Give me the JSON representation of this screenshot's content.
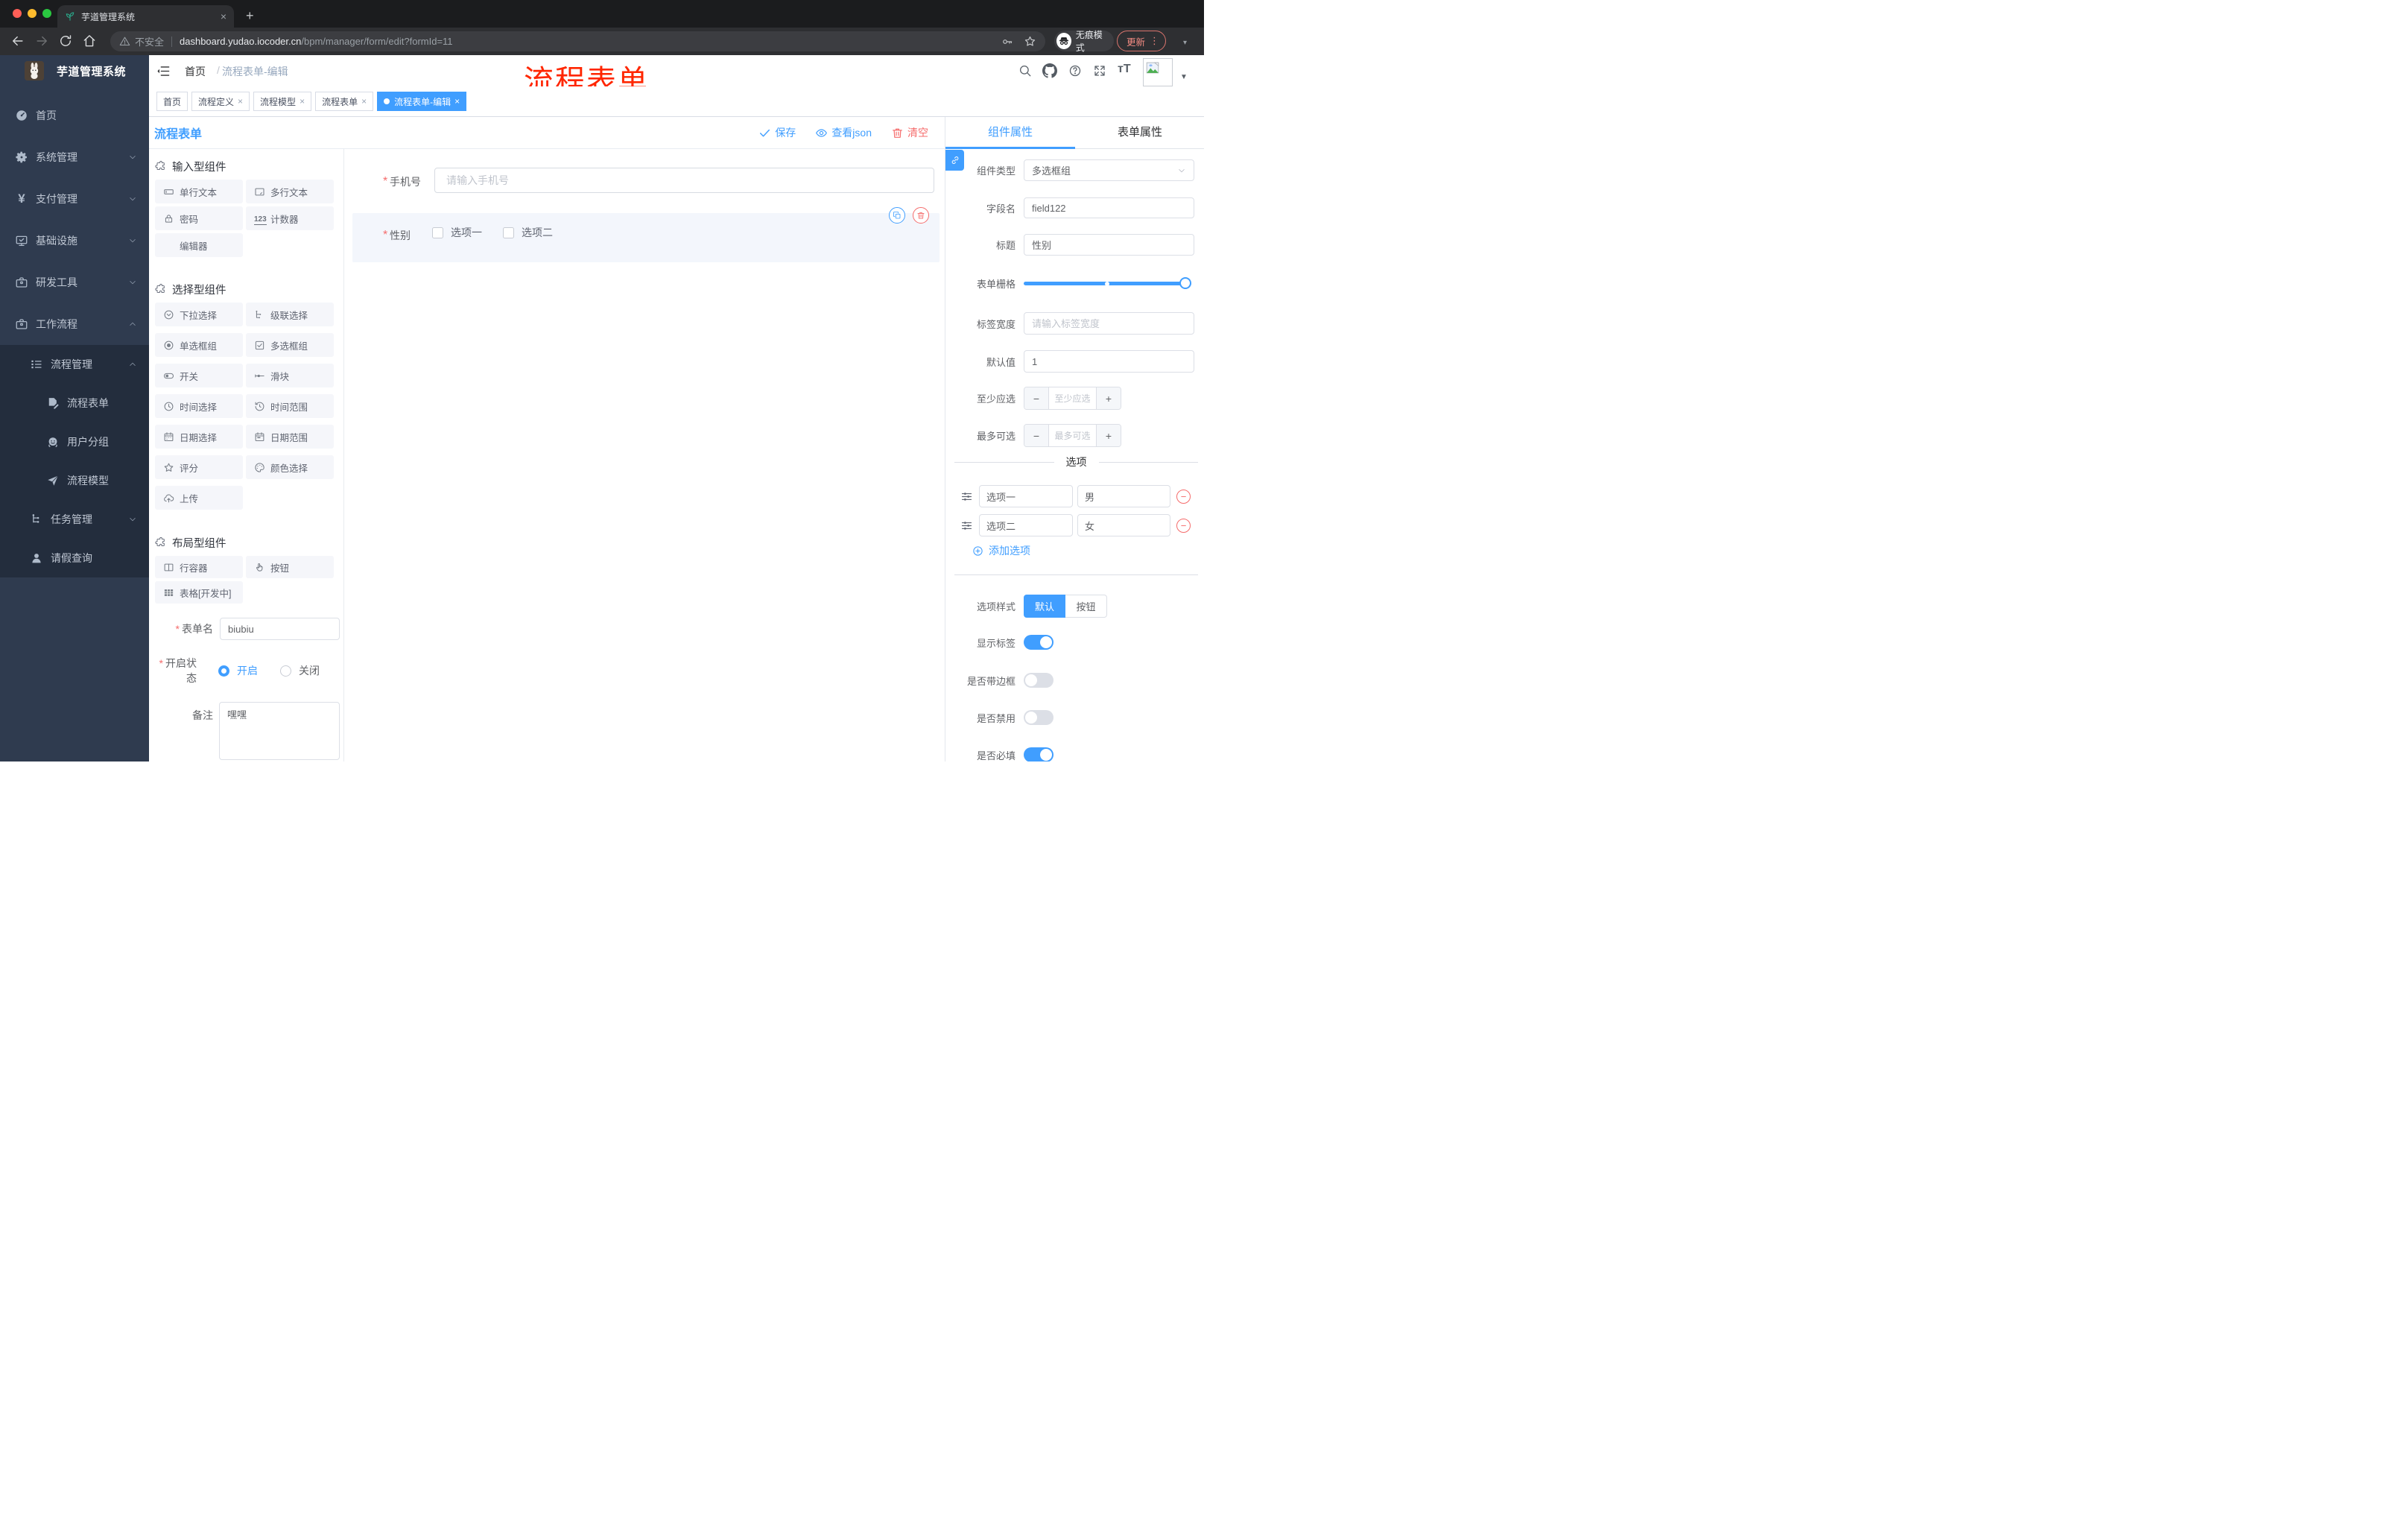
{
  "browser": {
    "tab_title": "芋道管理系统",
    "close_glyph": "×",
    "new_tab_glyph": "+",
    "security_label": "不安全",
    "url_host": "dashboard.yudao.iocoder.cn",
    "url_path": "/bpm/manager/form/edit?formId=11",
    "incognito_label": "无痕模式",
    "update_label": "更新",
    "menu_dots": "⋮"
  },
  "annotation": {
    "text": "流程表单",
    "color": "#ff2600"
  },
  "sidebar": {
    "logo_title": "芋道管理系统",
    "items": [
      {
        "label": "首页",
        "icon": "dashboard-icon",
        "depth": 0,
        "chevron": "",
        "sub": false
      },
      {
        "label": "系统管理",
        "icon": "gear-icon",
        "depth": 0,
        "chevron": "down",
        "sub": false
      },
      {
        "label": "支付管理",
        "icon": "yen-icon",
        "depth": 0,
        "chevron": "down",
        "sub": false
      },
      {
        "label": "基础设施",
        "icon": "monitor-icon",
        "depth": 0,
        "chevron": "down",
        "sub": false
      },
      {
        "label": "研发工具",
        "icon": "toolbox-icon",
        "depth": 0,
        "chevron": "down",
        "sub": false
      },
      {
        "label": "工作流程",
        "icon": "briefcase-icon",
        "depth": 0,
        "chevron": "up",
        "sub": false
      },
      {
        "label": "流程管理",
        "icon": "list-tree-icon",
        "depth": 1,
        "chevron": "up",
        "sub": true
      },
      {
        "label": "流程表单",
        "icon": "doc-edit-icon",
        "depth": 2,
        "chevron": "",
        "sub": true
      },
      {
        "label": "用户分组",
        "icon": "face-icon",
        "depth": 2,
        "chevron": "",
        "sub": true
      },
      {
        "label": "流程模型",
        "icon": "send-icon",
        "depth": 2,
        "chevron": "",
        "sub": true
      },
      {
        "label": "任务管理",
        "icon": "org-icon",
        "depth": 1,
        "chevron": "down",
        "sub": true
      },
      {
        "label": "请假查询",
        "icon": "user-icon",
        "depth": 1,
        "chevron": "",
        "sub": true
      }
    ]
  },
  "header": {
    "breadcrumb_home": "首页",
    "breadcrumb_sep": "/",
    "breadcrumb_current": "流程表单-编辑"
  },
  "tags": [
    {
      "label": "首页",
      "closable": false,
      "active": false
    },
    {
      "label": "流程定义",
      "closable": true,
      "active": false
    },
    {
      "label": "流程模型",
      "closable": true,
      "active": false
    },
    {
      "label": "流程表单",
      "closable": true,
      "active": false
    },
    {
      "label": "流程表单-编辑",
      "closable": true,
      "active": true
    }
  ],
  "designer_toolbar": {
    "title": "流程表单",
    "save_label": "保存",
    "view_json_label": "查看json",
    "clear_label": "清空"
  },
  "palette": {
    "sections": [
      {
        "title": "输入型组件",
        "items": [
          {
            "label": "单行文本",
            "icon": "input-icon"
          },
          {
            "label": "多行文本",
            "icon": "textarea-icon"
          },
          {
            "label": "密码",
            "icon": "lock-icon"
          },
          {
            "label": "计数器",
            "icon": "number-123-icon"
          },
          {
            "label": "编辑器",
            "icon": ""
          }
        ]
      },
      {
        "title": "选择型组件",
        "items": [
          {
            "label": "下拉选择",
            "icon": "select-icon"
          },
          {
            "label": "级联选择",
            "icon": "cascader-icon"
          },
          {
            "label": "单选框组",
            "icon": "radio-icon"
          },
          {
            "label": "多选框组",
            "icon": "checkbox-icon"
          },
          {
            "label": "开关",
            "icon": "switch-icon"
          },
          {
            "label": "滑块",
            "icon": "slider-icon"
          },
          {
            "label": "时间选择",
            "icon": "time-icon"
          },
          {
            "label": "时间范围",
            "icon": "time-range-icon"
          },
          {
            "label": "日期选择",
            "icon": "date-icon"
          },
          {
            "label": "日期范围",
            "icon": "date-range-icon"
          },
          {
            "label": "评分",
            "icon": "star-icon"
          },
          {
            "label": "颜色选择",
            "icon": "palette-icon"
          },
          {
            "label": "上传",
            "icon": "upload-icon"
          }
        ]
      },
      {
        "title": "布局型组件",
        "items": [
          {
            "label": "行容器",
            "icon": "columns-icon"
          },
          {
            "label": "按钮",
            "icon": "hand-pointer-icon"
          },
          {
            "label": "表格[开发中]",
            "icon": "table-icon"
          }
        ]
      }
    ]
  },
  "form_meta": {
    "name_label": "表单名",
    "name_value": "biubiu",
    "status_label": "开启状态",
    "status_on": "开启",
    "status_off": "关闭",
    "remark_label": "备注",
    "remark_value": "嘿嘿"
  },
  "canvas": {
    "phone": {
      "label": "手机号",
      "placeholder": "请输入手机号"
    },
    "gender": {
      "label": "性别",
      "options": [
        "选项一",
        "选项二"
      ]
    }
  },
  "props": {
    "tab_component": "组件属性",
    "tab_form": "表单属性",
    "component_type": {
      "label": "组件类型",
      "value": "多选框组"
    },
    "field_name": {
      "label": "字段名",
      "value": "field122"
    },
    "title": {
      "label": "标题",
      "value": "性别"
    },
    "grid": {
      "label": "表单栅格"
    },
    "label_width": {
      "label": "标签宽度",
      "placeholder": "请输入标签宽度"
    },
    "default_value": {
      "label": "默认值",
      "value": "1"
    },
    "min_select": {
      "label": "至少应选",
      "placeholder": "至少应选"
    },
    "max_select": {
      "label": "最多可选",
      "placeholder": "最多可选"
    },
    "options_title": "选项",
    "options": [
      {
        "name": "选项一",
        "value": "男"
      },
      {
        "name": "选项二",
        "value": "女"
      }
    ],
    "add_option_label": "添加选项",
    "option_style": {
      "label": "选项样式",
      "choices": [
        "默认",
        "按钮"
      ],
      "active_index": 0
    },
    "switches": [
      {
        "label": "显示标签",
        "on": true
      },
      {
        "label": "是否带边框",
        "on": false
      },
      {
        "label": "是否禁用",
        "on": false
      },
      {
        "label": "是否必填",
        "on": true
      }
    ]
  },
  "colors": {
    "primary": "#409eff",
    "danger": "#f56c6c",
    "sidebar_bg": "#2f3b4f",
    "submenu_bg": "#232d3d",
    "annotation": "#ff2600"
  }
}
